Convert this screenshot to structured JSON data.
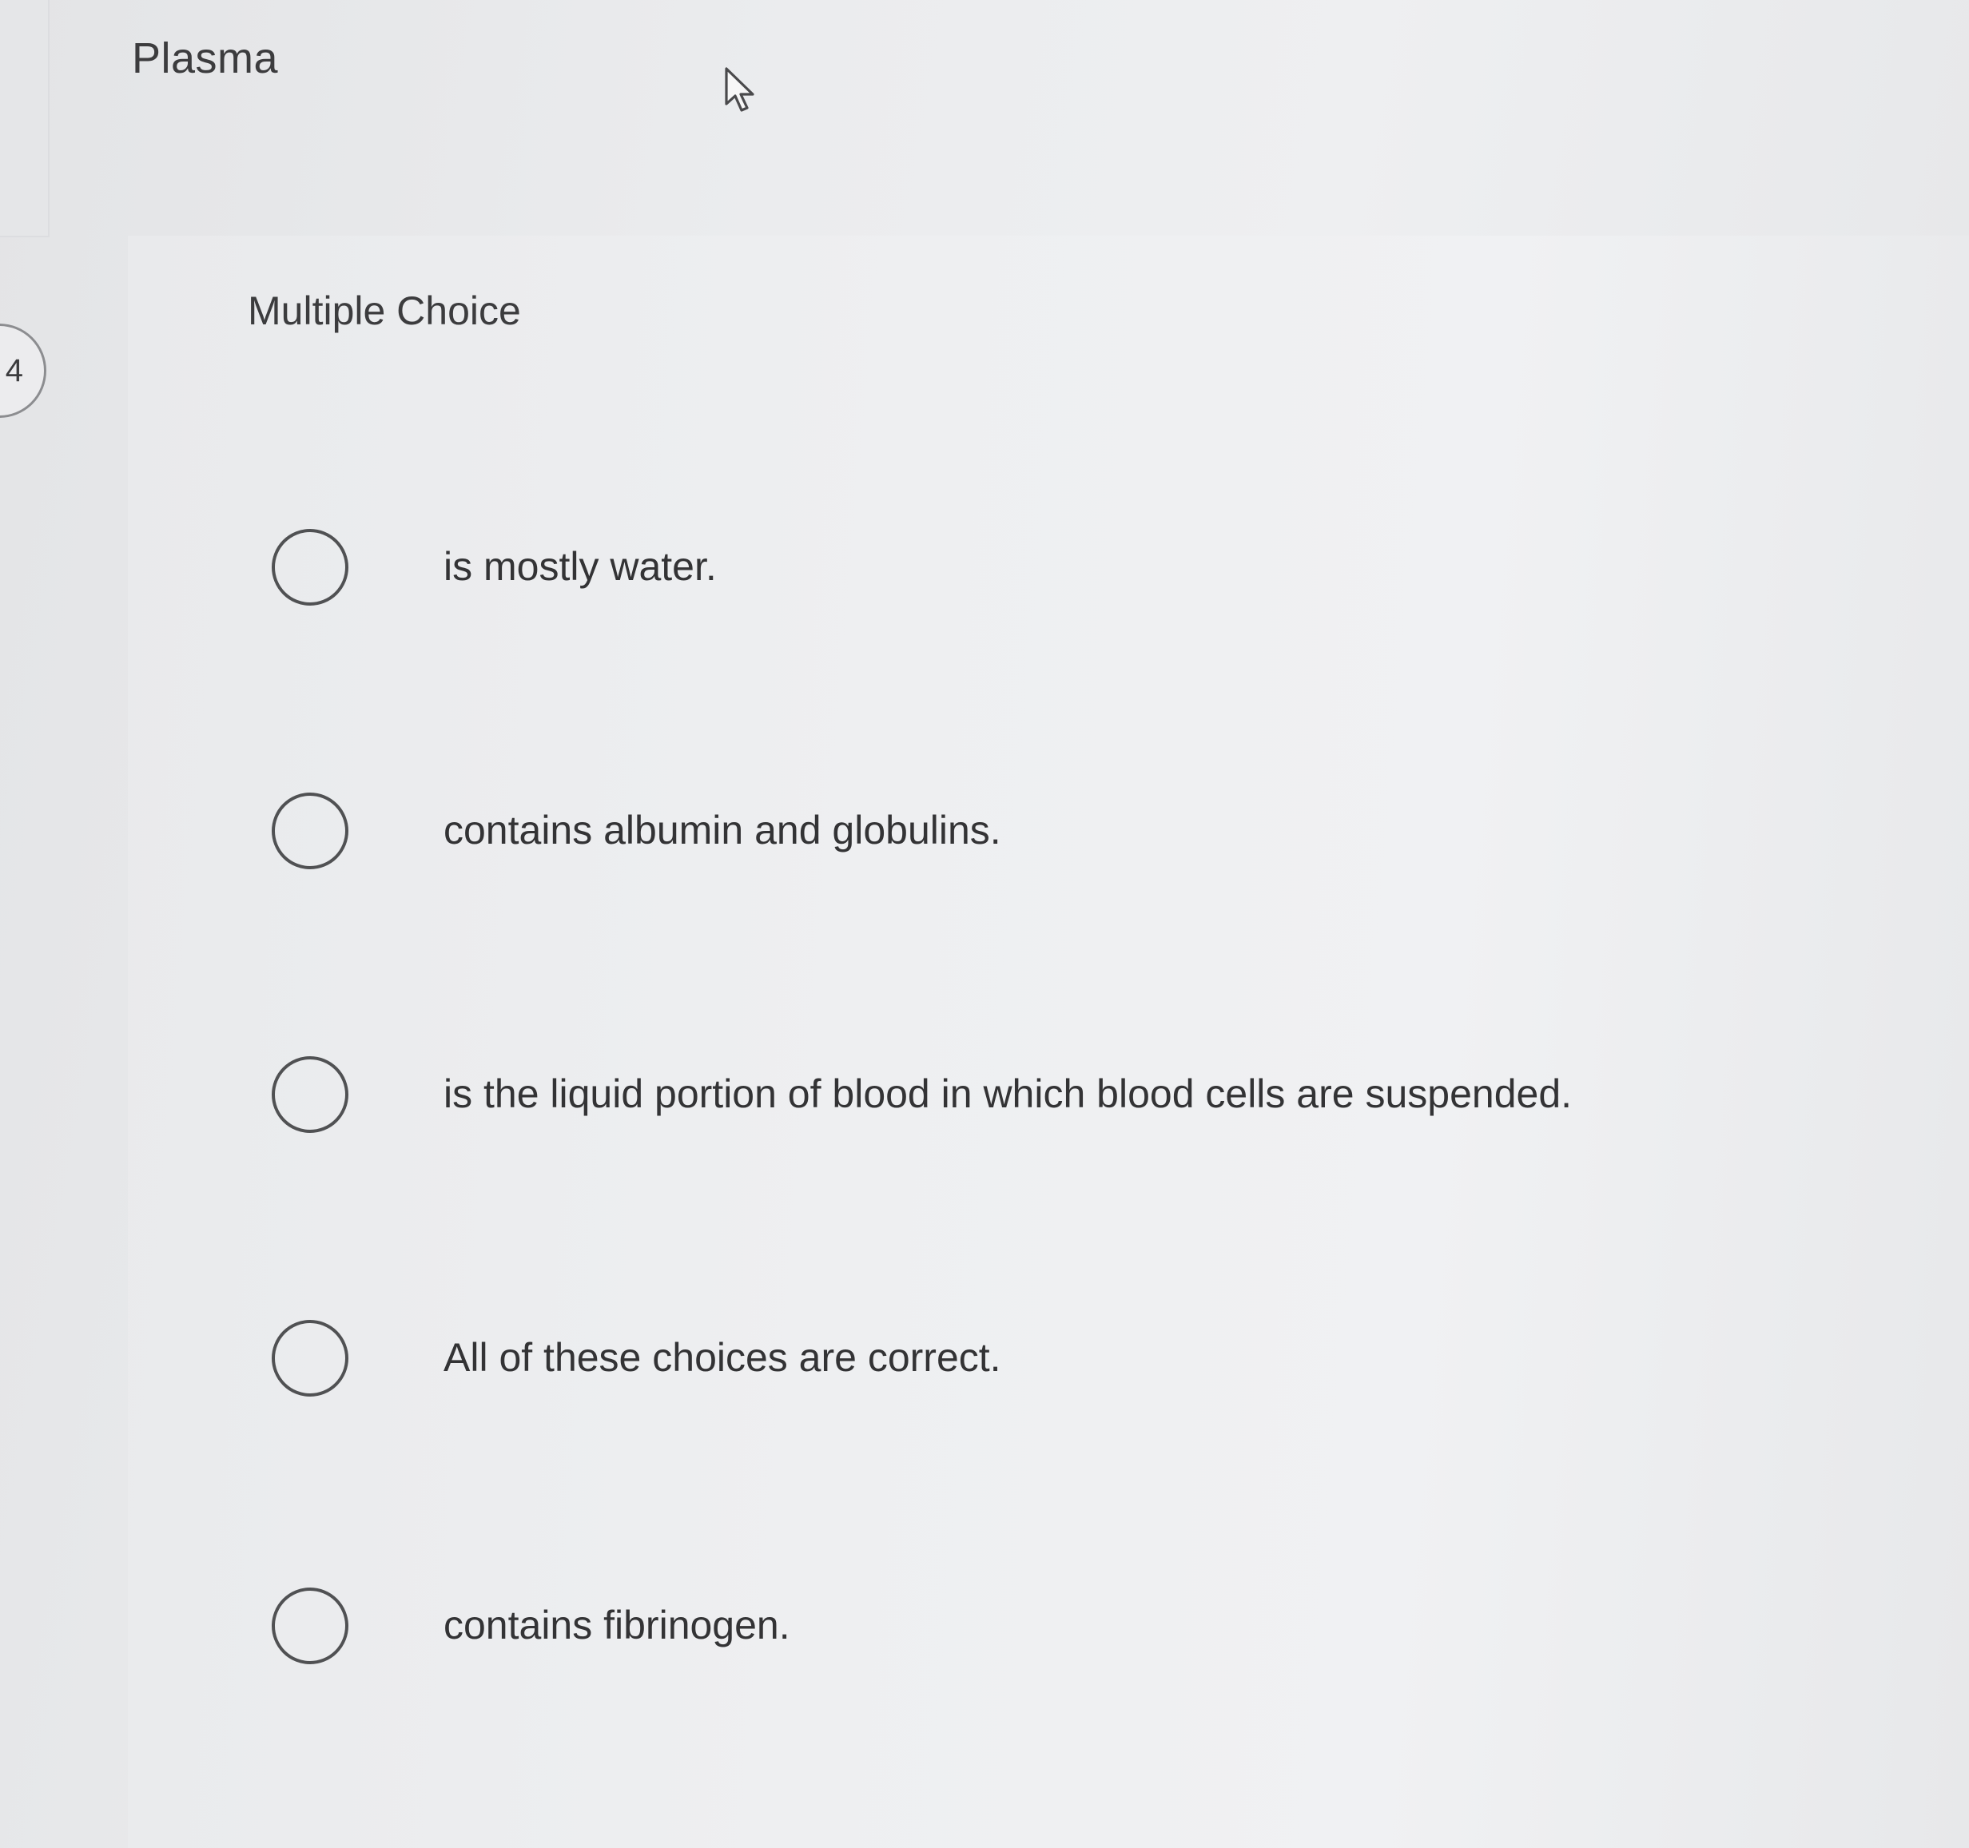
{
  "question": {
    "number": "4",
    "stem": "Plasma",
    "type_label": "Multiple Choice"
  },
  "choices": [
    {
      "label": "is mostly water.",
      "selected": false
    },
    {
      "label": "contains albumin and globulins.",
      "selected": false
    },
    {
      "label": "is the liquid portion of blood in which blood cells are suspended.",
      "selected": false
    },
    {
      "label": "All of these choices are correct.",
      "selected": false
    },
    {
      "label": "contains fibrinogen.",
      "selected": false
    }
  ],
  "icons": {
    "cursor": "mouse-pointer-icon",
    "radio": "radio-unselected-icon"
  },
  "colors": {
    "background": "#e6e7e9",
    "text": "#333335",
    "radio_border": "#505153"
  }
}
